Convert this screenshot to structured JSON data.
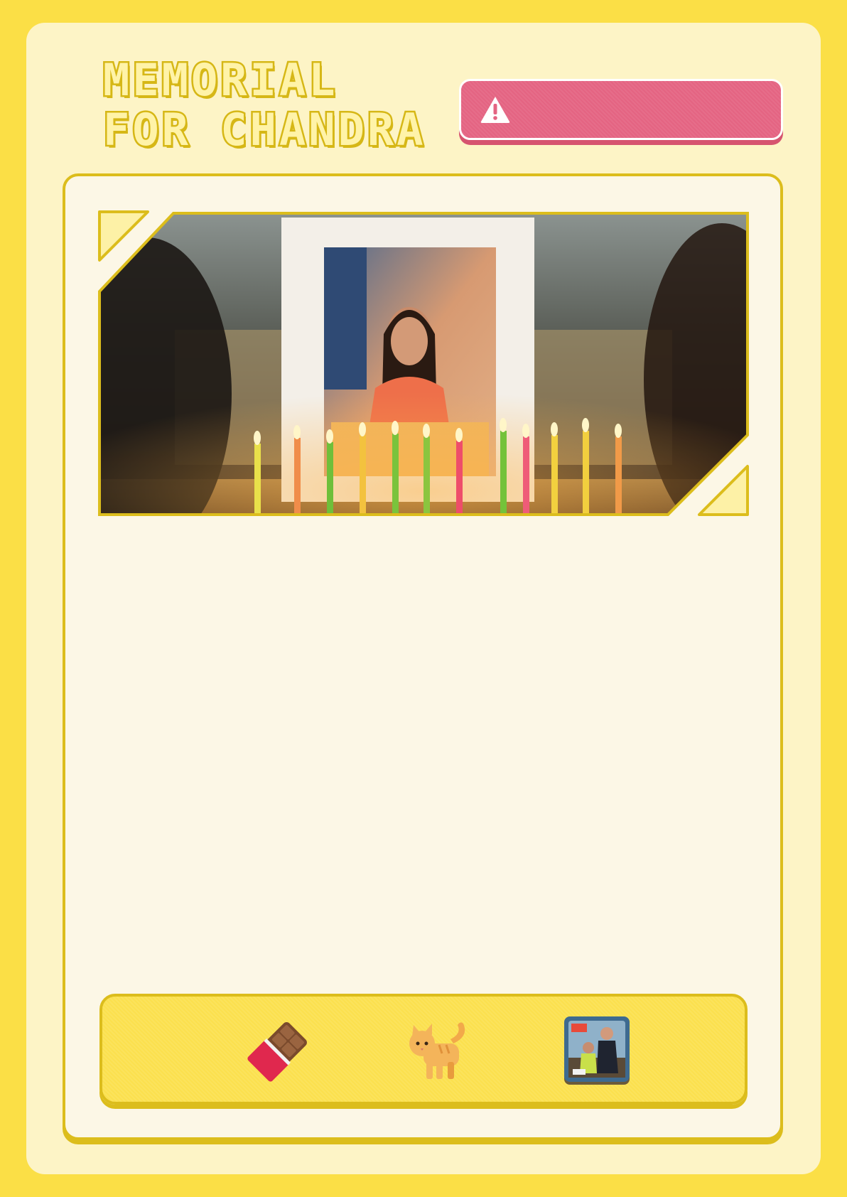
{
  "page": {
    "title_line_1": "MEMORIAL",
    "title_line_2": "FOR CHANDRA"
  },
  "alert": {
    "icon": "warning-triangle-icon",
    "text": "",
    "color": "#e46482"
  },
  "photo": {
    "description_icon": "memorial-photo-with-candles"
  },
  "tray": {
    "items": [
      {
        "icon": "chocolate-bar-icon"
      },
      {
        "icon": "cat-icon"
      },
      {
        "icon": "album-cover-icon"
      }
    ]
  },
  "colors": {
    "background": "#fbdf46",
    "card": "#fdf4c6",
    "panel": "#fcf7e6",
    "border": "#dcbd1c",
    "alert": "#e46482"
  }
}
